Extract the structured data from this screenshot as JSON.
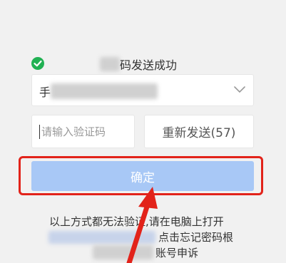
{
  "success": {
    "icon": "check-circle-icon",
    "text": "码发送成功",
    "icon_color": "#21b153"
  },
  "account": {
    "prefix": "手",
    "chevron_icon": "chevron-down-icon"
  },
  "code_input": {
    "placeholder": "请输入验证码"
  },
  "resend": {
    "label": "重新发送(57)"
  },
  "confirm": {
    "label": "确定",
    "color": "#a8c8f6",
    "highlight_color": "#e2231a"
  },
  "help": {
    "line1": "以上方式都无法验证,请在电脑上打开",
    "line2": "点击忘记密码根",
    "line3": "账号申诉"
  },
  "annotation": {
    "arrow_icon": "red-arrow-icon"
  }
}
